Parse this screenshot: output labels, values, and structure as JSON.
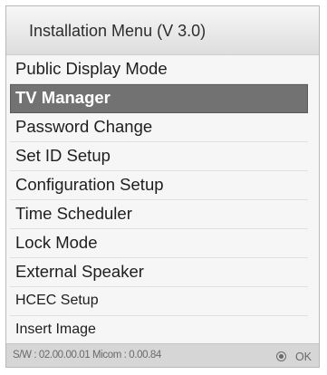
{
  "window": {
    "title": "Installation Menu (V 3.0)"
  },
  "menu": {
    "items": [
      {
        "label": "Public Display Mode"
      },
      {
        "label": "TV Manager"
      },
      {
        "label": "Password Change"
      },
      {
        "label": "Set ID Setup"
      },
      {
        "label": "Configuration Setup"
      },
      {
        "label": "Time Scheduler"
      },
      {
        "label": "Lock Mode"
      },
      {
        "label": "External Speaker"
      },
      {
        "label": "HCEC Setup"
      },
      {
        "label": "Insert Image"
      }
    ],
    "selected_index": 1
  },
  "status": {
    "version_text": "S/W : 02.00.00.01 Micom : 0.00.84",
    "ok_label": "OK",
    "ok_icon": "radio-ok-icon"
  },
  "colors": {
    "selected_bg": "#727272",
    "selected_text": "#ffffff",
    "panel_bg": "#f6f6f6",
    "status_bg": "#d6d6d6"
  }
}
